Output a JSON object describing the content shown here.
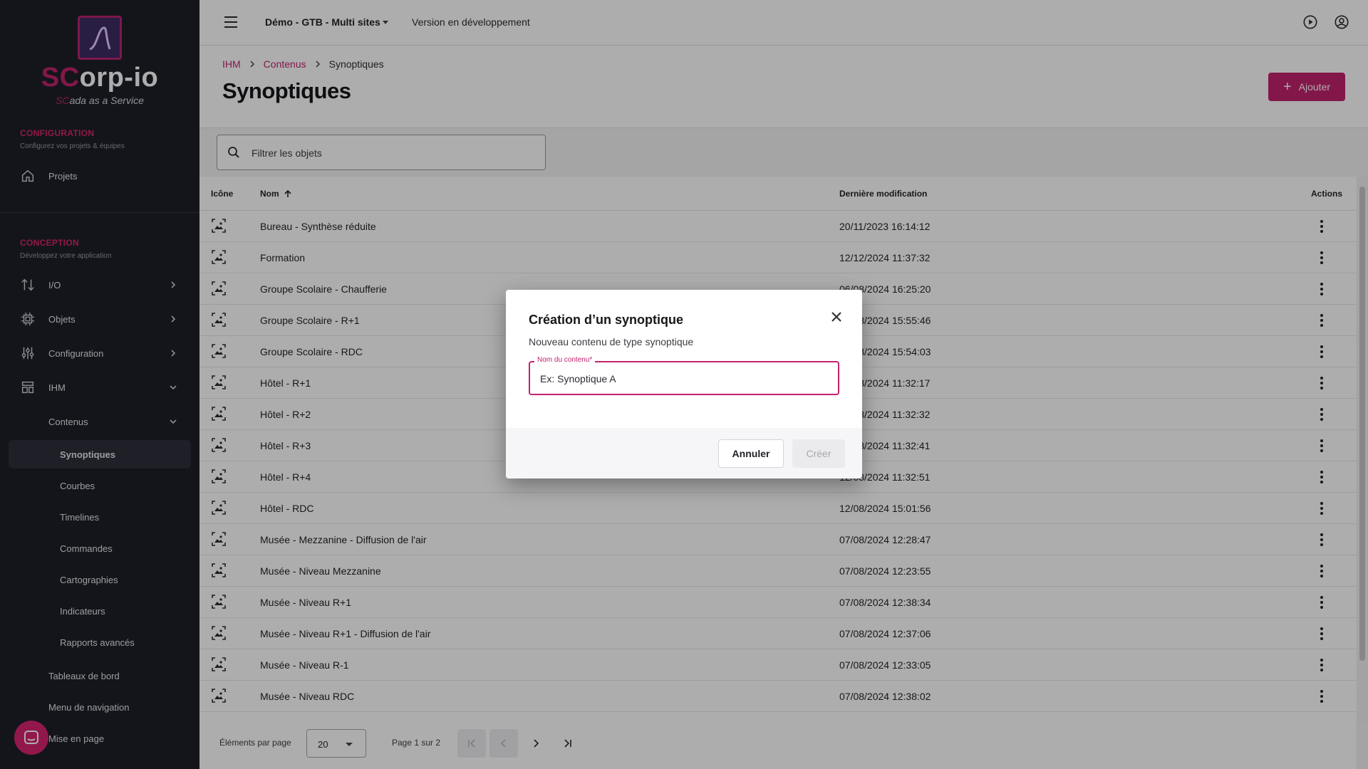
{
  "sidebar": {
    "logo": {
      "sc": "SC",
      "rest": "orp-io",
      "tag_sc": "SC",
      "tag_rest": "ada as a Service"
    },
    "configuration": {
      "title": "CONFIGURATION",
      "subtitle": "Configurez vos projets & équipes",
      "items": [
        {
          "label": "Projets",
          "icon": "home-icon"
        }
      ]
    },
    "conception": {
      "title": "CONCEPTION",
      "subtitle": "Développez votre application",
      "items": [
        {
          "label": "I/O",
          "icon": "arrows-updown-icon"
        },
        {
          "label": "Objets",
          "icon": "chip-icon"
        },
        {
          "label": "Configuration",
          "icon": "sliders-icon"
        },
        {
          "label": "IHM",
          "icon": "layout-icon"
        }
      ],
      "contenus": "Contenus",
      "sub_items": [
        "Synoptiques",
        "Courbes",
        "Timelines",
        "Commandes",
        "Cartographies",
        "Indicateurs",
        "Rapports avancés"
      ],
      "lower_items": [
        "Tableaux de bord",
        "Menu de navigation",
        "Mise en page"
      ]
    }
  },
  "topbar": {
    "project": "Démo - GTB - Multi sites",
    "environment": "Version en développement"
  },
  "header": {
    "breadcrumb": [
      "IHM",
      "Contenus",
      "Synoptiques"
    ],
    "title": "Synoptiques",
    "add_label": "Ajouter"
  },
  "filter": {
    "placeholder": "Filtrer les objets"
  },
  "table": {
    "columns": {
      "icon": "Icône",
      "name": "Nom",
      "modified": "Dernière modification",
      "actions": "Actions"
    },
    "rows": [
      {
        "name": "Bureau - Synthèse réduite",
        "date": "20/11/2023 16:14:12"
      },
      {
        "name": "Formation",
        "date": "12/12/2024 11:37:32"
      },
      {
        "name": "Groupe Scolaire - Chaufferie",
        "date": "06/08/2024 16:25:20"
      },
      {
        "name": "Groupe Scolaire - R+1",
        "date": "06/08/2024 15:55:46"
      },
      {
        "name": "Groupe Scolaire - RDC",
        "date": "06/08/2024 15:54:03"
      },
      {
        "name": "Hôtel - R+1",
        "date": "12/08/2024 11:32:17"
      },
      {
        "name": "Hôtel - R+2",
        "date": "12/08/2024 11:32:32"
      },
      {
        "name": "Hôtel - R+3",
        "date": "12/08/2024 11:32:41"
      },
      {
        "name": "Hôtel - R+4",
        "date": "12/08/2024 11:32:51"
      },
      {
        "name": "Hôtel - RDC",
        "date": "12/08/2024 15:01:56"
      },
      {
        "name": "Musée - Mezzanine - Diffusion de l'air",
        "date": "07/08/2024 12:28:47"
      },
      {
        "name": "Musée - Niveau Mezzanine",
        "date": "07/08/2024 12:23:55"
      },
      {
        "name": "Musée - Niveau R+1",
        "date": "07/08/2024 12:38:34"
      },
      {
        "name": "Musée - Niveau R+1 - Diffusion de l'air",
        "date": "07/08/2024 12:37:06"
      },
      {
        "name": "Musée - Niveau R-1",
        "date": "07/08/2024 12:33:05"
      },
      {
        "name": "Musée - Niveau RDC",
        "date": "07/08/2024 12:38:02"
      }
    ]
  },
  "pagination": {
    "per_page_label": "Éléments par page",
    "per_page_value": "20",
    "page_label": "Page 1 sur 2"
  },
  "dialog": {
    "title": "Création d’un synoptique",
    "subtitle": "Nouveau contenu de type synoptique",
    "field_label": "Nom du contenu*",
    "field_placeholder": "Ex: Synoptique A",
    "cancel": "Annuler",
    "create": "Créer"
  },
  "colors": {
    "accent": "#c2226e",
    "sidebar_bg": "#1e2028"
  }
}
